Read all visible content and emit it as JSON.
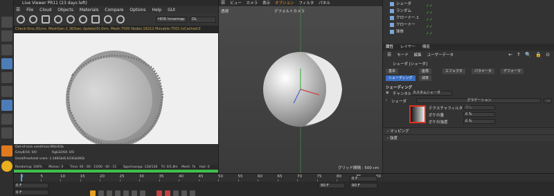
{
  "live_viewer": {
    "title": "Live Viewer PR11 (23 days left)",
    "menu": [
      "File",
      "Cloud",
      "Objects",
      "Materials",
      "Compare",
      "Options",
      "Help",
      "GUI"
    ],
    "tonemap": "HDR tonemap",
    "tonemap_value": "DL",
    "status": "Check:0ms./61ms. MeshGen:1.363sec Update(0):0ms. Mesh:7500 Nodes:16212 Movable:7501 txCached:0",
    "info": {
      "out_of_core": "Out-of-core used/max:0Kb/4Gb",
      "grey": "Grey8/16: 0/0",
      "rgb": "Rgb32/64: 0/0",
      "vram": "Used/free/total vram: 1.346Gb/6.633Gb/8Gb"
    },
    "progress": {
      "rendering": "Rendering: 100%",
      "mssec": "Ms/sec: 0",
      "time": "Time: 00 : 00 : 15/00 : 00 : 15",
      "spp": "Spp/maxspp: 128/128",
      "tri": "Tri: 0/1.8m",
      "mesh": "Mesh: 7k",
      "hair": "Hair: 0",
      "fraction": 1.0
    }
  },
  "viewport": {
    "menu": [
      "ビュー",
      "カメラ",
      "表示",
      "オプション",
      "フィルタ",
      "パネル"
    ],
    "highlight_menu": "オプション",
    "perspective": "透視",
    "camera": "デフォルトカメラ",
    "grid": "グリッド間隔 : 500 cm"
  },
  "objects": [
    {
      "name": "シェーダ"
    },
    {
      "name": "ランダム"
    },
    {
      "name": "クローナー.1"
    },
    {
      "name": "クローナー"
    },
    {
      "name": "球体"
    }
  ],
  "attributes": {
    "tabs": [
      "属性",
      "レイヤー",
      "構造"
    ],
    "active_tab": "属性",
    "mode_items": [
      "モード",
      "編集",
      "ユーザーデータ"
    ],
    "object_title": "シェーダ [シェーダ]",
    "subtabs_row1": [
      "基本",
      "座標",
      "エフェクタ",
      "パラメータ",
      "デフォーマ"
    ],
    "subtabs_row2": [
      "シェーディング",
      "減衰"
    ],
    "active_subtab": "シェーディング",
    "section_title": "シェーディング",
    "channel_label": "チャンネル",
    "channel_value": "カスタムシェーダ",
    "shader_label": "シェーダ",
    "shader_value": "グラデーション",
    "texture_filter_label": "テクスチャフィルタ",
    "texture_filter_value": "なし",
    "blur_amount_label": "ボケの量",
    "blur_amount_value": "0 %",
    "blur_strength_label": "ボケの強度",
    "blur_strength_value": "0 %",
    "sections": [
      "マッピング",
      "強度"
    ]
  },
  "timeline": {
    "ticks": [
      "0",
      "5",
      "10",
      "15",
      "20",
      "25",
      "30",
      "35",
      "40",
      "45",
      "50",
      "55",
      "60",
      "65",
      "70",
      "75",
      "80",
      "85",
      "90"
    ],
    "start_field": "0 F",
    "start_field2": "0 F",
    "end_field": "90 F",
    "end_field2": "90 F",
    "current_field": "0 F"
  }
}
